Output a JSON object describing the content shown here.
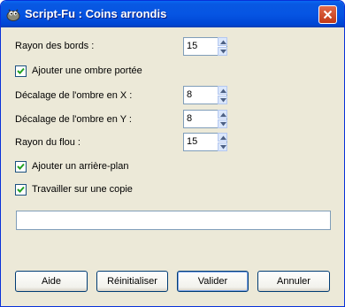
{
  "window": {
    "title": "Script-Fu : Coins arrondis"
  },
  "fields": {
    "radius": {
      "label": "Rayon des bords :",
      "value": "15"
    },
    "shadow": {
      "label": "Ajouter une ombre portée",
      "checked": true
    },
    "offset_x": {
      "label": "Décalage de l'ombre en X :",
      "value": "8"
    },
    "offset_y": {
      "label": "Décalage de l'ombre en Y :",
      "value": "8"
    },
    "blur": {
      "label": "Rayon du flou :",
      "value": "15"
    },
    "background": {
      "label": "Ajouter un arrière-plan",
      "checked": true
    },
    "copy": {
      "label": "Travailler sur une copie",
      "checked": true
    },
    "progress_text": ""
  },
  "buttons": {
    "help": "Aide",
    "reset": "Réinitialiser",
    "ok": "Valider",
    "cancel": "Annuler"
  },
  "icons": {
    "app": "gimp-icon",
    "close": "close-icon",
    "up": "arrow-up-icon",
    "down": "arrow-down-icon",
    "check": "checkmark-icon"
  }
}
